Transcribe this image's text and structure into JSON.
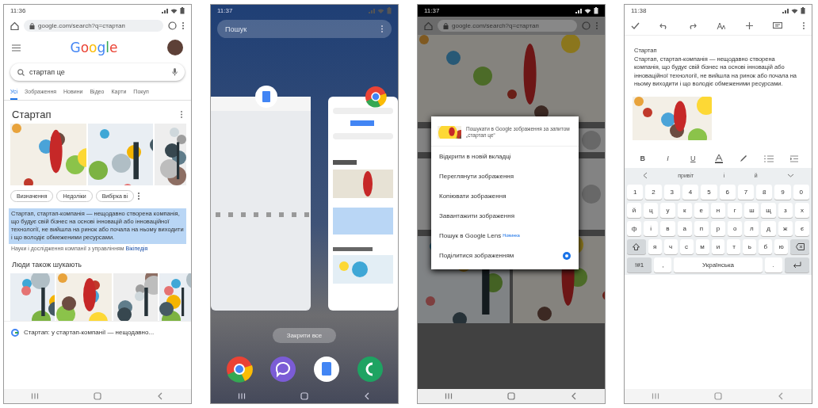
{
  "screens": [
    {
      "kind": "search",
      "status_bar": {
        "time": "11:36"
      },
      "address_bar": {
        "url": "google.com/search?q=стартап"
      },
      "logo": "Google",
      "search": {
        "value": "стартап це"
      },
      "tabs": [
        {
          "label": "Усі",
          "selected": true
        },
        {
          "label": "Зображення",
          "selected": false
        },
        {
          "label": "Новини",
          "selected": false
        },
        {
          "label": "Відео",
          "selected": false
        },
        {
          "label": "Карти",
          "selected": false
        },
        {
          "label": "Покуп",
          "selected": false
        }
      ],
      "result": {
        "title": "Стартап",
        "chips": [
          "Визначення",
          "Недоліки",
          "Вибірка ві"
        ],
        "snippet": "Стартап, стартап-компанія — нещодавно створена компанія, що будує свій бізнес на основі інновацій або інноваційної технології, не вийшла на ринок або почала на ньому виходити і що володіє обмеженими ресурсами.",
        "highlighted": true,
        "source": "Науки і дослідження компанії з управлінням",
        "link": "Вікіпедія"
      },
      "related": {
        "title": "Люди також шукають"
      },
      "bottom_result": "Стартап: у стартап-компанії — нещодавно..."
    },
    {
      "kind": "recents",
      "status_bar": {
        "time": "11:37"
      },
      "search": {
        "placeholder": "Пошук"
      },
      "close_all": "Закрити все"
    },
    {
      "kind": "menu",
      "status_bar": {
        "time": "11:37"
      },
      "address_bar": {
        "url": "google.com/search?q=стартап"
      },
      "menu": {
        "title": "Пошукати в Google зображення за запитом „стартап це“",
        "items": [
          {
            "kind": "plain",
            "label": "Відкрити в новій вкладці"
          },
          {
            "kind": "plain",
            "label": "Переглянути зображення"
          },
          {
            "kind": "plain",
            "label": "Копіювати зображення"
          },
          {
            "kind": "plain",
            "label": "Завантажити зображення"
          },
          {
            "kind": "badge",
            "label": "Пошук в Google Lens",
            "badge": "Новинка"
          },
          {
            "kind": "lens",
            "label": "Поділитися зображенням"
          }
        ]
      }
    },
    {
      "kind": "editor",
      "status_bar": {
        "time": "11:38"
      },
      "document": {
        "title": "Стартап",
        "body": "Стартап, стартап-компанія — нещодавно створена компанія, що будує свій бізнес на основі інновацій або інноваційної технології, не вийшла на ринок або почала на ньому виходити і що володіє обмеженими ресурсами."
      },
      "format_buttons": [
        "B",
        "I",
        "U"
      ],
      "keyboard": {
        "suggestions": [
          "привіт",
          "і",
          "й"
        ],
        "rows": [
          {
            "kind": "plain",
            "keys": [
              "1",
              "2",
              "3",
              "4",
              "5",
              "6",
              "7",
              "8",
              "9",
              "0"
            ]
          },
          {
            "kind": "plain",
            "keys": [
              "й",
              "ц",
              "у",
              "к",
              "е",
              "н",
              "г",
              "ш",
              "щ",
              "з",
              "х"
            ]
          },
          {
            "kind": "plain",
            "keys": [
              "ф",
              "і",
              "в",
              "а",
              "п",
              "р",
              "о",
              "л",
              "д",
              "ж",
              "є"
            ]
          },
          {
            "kind": "shift",
            "keys": [
              "я",
              "ч",
              "с",
              "м",
              "и",
              "т",
              "ь",
              "б",
              "ю"
            ]
          }
        ],
        "mode": "!#1",
        "comma": ",",
        "space": "Українська",
        "period": "."
      }
    }
  ]
}
